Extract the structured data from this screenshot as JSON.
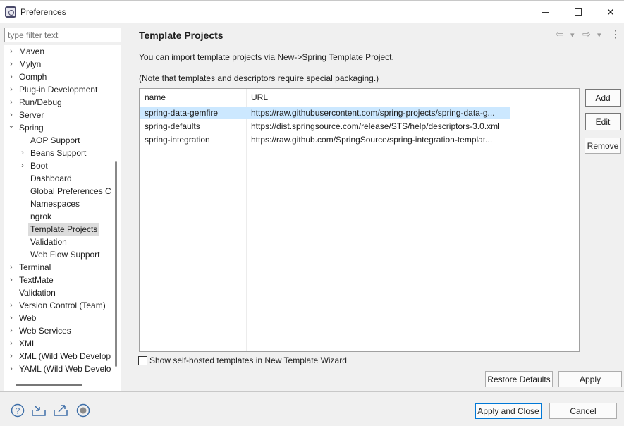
{
  "window": {
    "title": "Preferences",
    "min_label": "",
    "max_label": "",
    "close_label": "✕"
  },
  "filter": {
    "placeholder": "type filter text"
  },
  "tree": {
    "items": [
      {
        "label": "Maven",
        "chevron": "›"
      },
      {
        "label": "Mylyn",
        "chevron": "›"
      },
      {
        "label": "Oomph",
        "chevron": "›"
      },
      {
        "label": "Plug-in Development",
        "chevron": "›"
      },
      {
        "label": "Run/Debug",
        "chevron": "›"
      },
      {
        "label": "Server",
        "chevron": "›"
      },
      {
        "label": "Spring",
        "chevron": "⌄"
      },
      {
        "label": "AOP Support",
        "chevron": ""
      },
      {
        "label": "Beans Support",
        "chevron": "›"
      },
      {
        "label": "Boot",
        "chevron": "›"
      },
      {
        "label": "Dashboard",
        "chevron": ""
      },
      {
        "label": "Global Preferences C",
        "chevron": ""
      },
      {
        "label": "Namespaces",
        "chevron": ""
      },
      {
        "label": "ngrok",
        "chevron": ""
      },
      {
        "label": "Template Projects",
        "chevron": ""
      },
      {
        "label": "Validation",
        "chevron": ""
      },
      {
        "label": "Web Flow Support",
        "chevron": ""
      },
      {
        "label": "Terminal",
        "chevron": "›"
      },
      {
        "label": "TextMate",
        "chevron": "›"
      },
      {
        "label": "Validation",
        "chevron": ""
      },
      {
        "label": "Version Control (Team)",
        "chevron": "›"
      },
      {
        "label": "Web",
        "chevron": "›"
      },
      {
        "label": "Web Services",
        "chevron": "›"
      },
      {
        "label": "XML",
        "chevron": "›"
      },
      {
        "label": "XML (Wild Web Develop",
        "chevron": "›"
      },
      {
        "label": "YAML (Wild Web Develo",
        "chevron": "›"
      }
    ]
  },
  "page": {
    "title": "Template Projects",
    "nav": {
      "back": "⇦",
      "back_menu": "▾",
      "forward": "⇨",
      "forward_menu": "▾",
      "more": "⋮"
    },
    "info_line1": "You can import template projects via New->Spring Template Project.",
    "info_line2": "(Note that templates and descriptors require special packaging.)"
  },
  "table": {
    "headers": [
      "name",
      "URL"
    ],
    "rows": [
      {
        "name": "spring-data-gemfire",
        "url": "https://raw.githubusercontent.com/spring-projects/spring-data-g..."
      },
      {
        "name": "spring-defaults",
        "url": "https://dist.springsource.com/release/STS/help/descriptors-3.0.xml"
      },
      {
        "name": "spring-integration",
        "url": "https://raw.github.com/SpringSource/spring-integration-templat..."
      }
    ]
  },
  "side_buttons": {
    "add": "Add",
    "edit": "Edit",
    "remove": "Remove"
  },
  "checkbox": {
    "label": "Show self-hosted templates in New Template Wizard",
    "checked": false
  },
  "buttons": {
    "restore_defaults": "Restore Defaults",
    "apply": "Apply",
    "apply_and_close": "Apply and Close",
    "cancel": "Cancel"
  },
  "footer_icons": [
    "help-icon",
    "import-icon",
    "export-icon",
    "record-icon"
  ]
}
